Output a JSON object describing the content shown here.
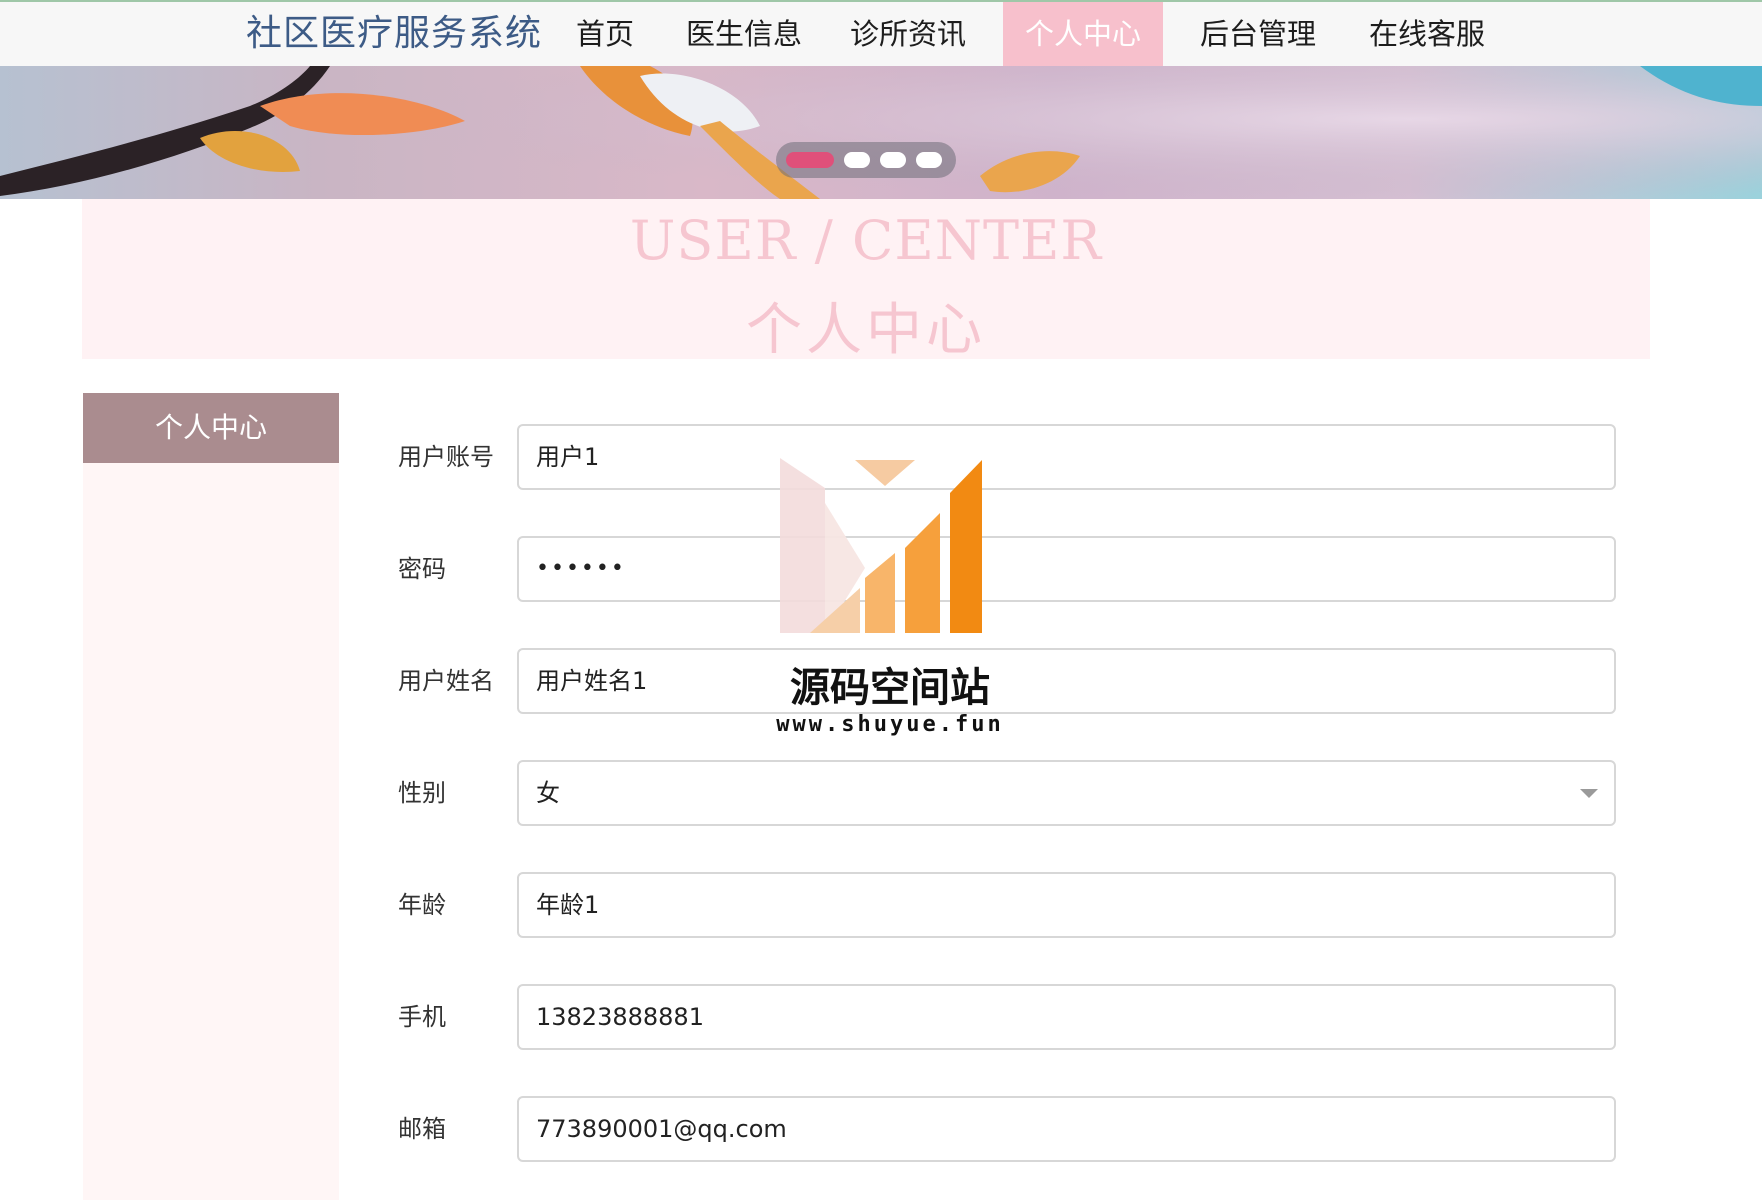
{
  "nav": {
    "brand": "社区医疗服务系统",
    "items": [
      "首页",
      "医生信息",
      "诊所资讯",
      "个人中心",
      "后台管理",
      "在线客服"
    ],
    "active_index": 3
  },
  "banner": {
    "slides_count": 4,
    "active_slide": 1
  },
  "title": {
    "en": "USER / CENTER",
    "zh": "个人中心"
  },
  "sidebar": {
    "heading": "个人中心"
  },
  "form": {
    "account_label": "用户账号",
    "account_value": "用户1",
    "password_label": "密码",
    "password_value": "••••••",
    "name_label": "用户姓名",
    "name_value": "用户姓名1",
    "gender_label": "性别",
    "gender_value": "女",
    "age_label": "年龄",
    "age_value": "年龄1",
    "phone_label": "手机",
    "phone_value": "13823888881",
    "email_label": "邮箱",
    "email_value": "773890001@qq.com"
  },
  "watermark": {
    "text": "源码空间站",
    "url": "www.shuyue.fun"
  },
  "colors": {
    "brand": "#3d5b86",
    "nav_active_bg": "#f7c0cc",
    "title_pink": "#f6c6d0",
    "sidebar_head": "#aa8c8f",
    "dot_active": "#e0507a"
  }
}
